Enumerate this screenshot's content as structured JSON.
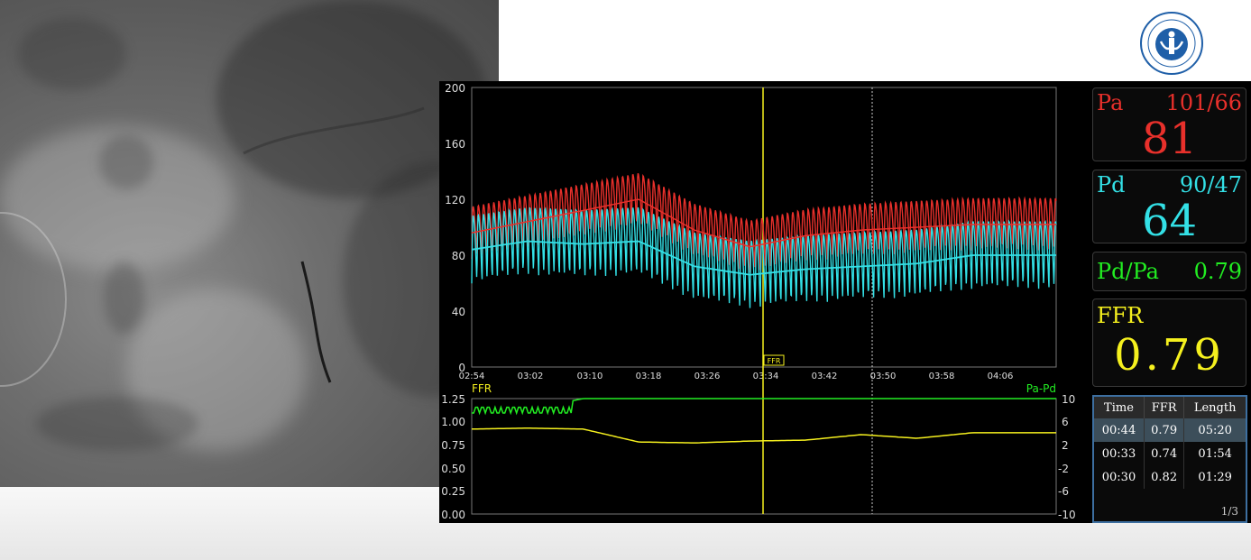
{
  "logo": {
    "text": ""
  },
  "monitor": {
    "top_chart": {
      "y_ticks": [
        "200",
        "160",
        "120",
        "80",
        "40",
        "0"
      ],
      "x_ticks": [
        "02:54",
        "03:02",
        "03:10",
        "03:18",
        "03:26",
        "03:34",
        "03:42",
        "03:50",
        "03:58",
        "04:06"
      ],
      "marker_label": "FFR"
    },
    "bottom_chart": {
      "left_label": "FFR",
      "right_label": "Pa-Pd",
      "left_ticks": [
        "1.25",
        "1.00",
        "0.75",
        "0.50",
        "0.25",
        "0.00"
      ],
      "right_ticks": [
        "10",
        "6",
        "2",
        "-2",
        "-6",
        "-10"
      ]
    },
    "pa": {
      "label": "Pa",
      "systolic_diastolic": "101/66",
      "mean": "81"
    },
    "pd": {
      "label": "Pd",
      "systolic_diastolic": "90/47",
      "mean": "64"
    },
    "ratio": {
      "label": "Pd/Pa",
      "value": "0.79"
    },
    "ffr": {
      "label": "FFR",
      "value": "0.79"
    },
    "table": {
      "headers": [
        "Time",
        "FFR",
        "Length"
      ],
      "rows": [
        [
          "00:44",
          "0.79",
          "05:20"
        ],
        [
          "00:33",
          "0.74",
          "01:54"
        ],
        [
          "00:30",
          "0.82",
          "01:29"
        ]
      ],
      "page": "1/3"
    }
  },
  "colors": {
    "pa": "#e8302b",
    "pd": "#33e0e6",
    "ffr": "#f5f01e",
    "papd": "#22ee22",
    "background": "#000000"
  },
  "chart_data": [
    {
      "type": "line",
      "title": "",
      "xlabel": "",
      "ylabel": "",
      "x": [
        "02:54",
        "03:02",
        "03:10",
        "03:18",
        "03:26",
        "03:34",
        "03:42",
        "03:50",
        "03:58",
        "04:06"
      ],
      "ylim": [
        0,
        200
      ],
      "series": [
        {
          "name": "Pa",
          "values": [
            96,
            104,
            112,
            120,
            98,
            86,
            94,
            98,
            100,
            102
          ]
        },
        {
          "name": "Pd",
          "values": [
            84,
            90,
            88,
            90,
            72,
            66,
            70,
            72,
            74,
            80
          ]
        }
      ]
    },
    {
      "type": "line",
      "title": "",
      "x": [
        "02:54",
        "03:02",
        "03:10",
        "03:18",
        "03:26",
        "03:34",
        "03:42",
        "03:50",
        "03:58",
        "04:06"
      ],
      "ylim": [
        0,
        1.25
      ],
      "y2lim": [
        -10,
        10
      ],
      "series": [
        {
          "name": "FFR",
          "values": [
            0.92,
            0.93,
            0.92,
            0.78,
            0.77,
            0.79,
            0.8,
            0.86,
            0.82,
            0.88
          ]
        },
        {
          "name": "Pa-Pd",
          "values": [
            8,
            8,
            10,
            10,
            10,
            10,
            10,
            10,
            10,
            10
          ]
        }
      ]
    }
  ]
}
